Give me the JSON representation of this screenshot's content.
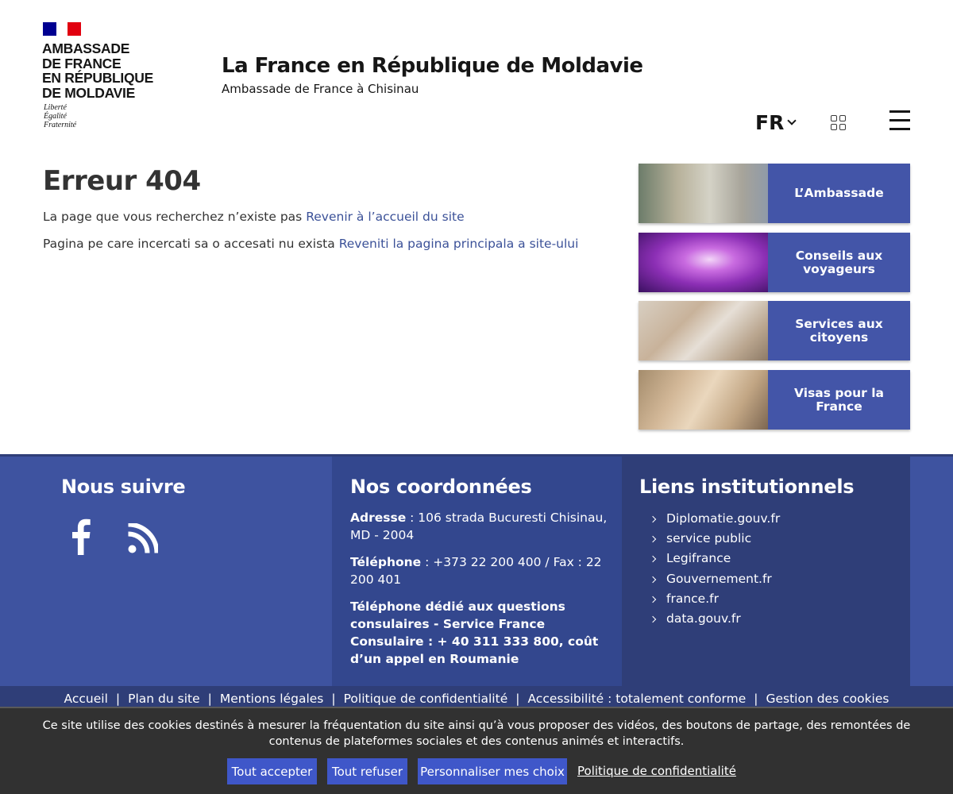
{
  "header": {
    "embassy_lines": [
      "AMBASSADE",
      "DE FRANCE",
      "EN RÉPUBLIQUE",
      "DE MOLDAVIE"
    ],
    "motto_lines": [
      "Liberté",
      "Égalité",
      "Fraternité"
    ],
    "site_title": "La France en République de Moldavie",
    "site_subtitle": "Ambassade de France à Chisinau",
    "language": "FR"
  },
  "main": {
    "title": "Erreur 404",
    "line1_text": "La page que vous recherchez n’existe pas ",
    "line1_link": "Revenir à l’accueil du site",
    "line2_text": "Pagina pe care incercati sa o accesati nu exista ",
    "line2_link": "Reveniti la pagina principala a site-ului"
  },
  "cards": [
    {
      "label": "L’Ambassade"
    },
    {
      "label": "Conseils aux voyageurs"
    },
    {
      "label": "Services aux citoyens"
    },
    {
      "label": "Visas pour la France"
    }
  ],
  "footer": {
    "follow_title": "Nous suivre",
    "contact_title": "Nos coordonnées",
    "address_label": "Adresse",
    "address_value": " : 106 strada Bucuresti Chisinau, MD - 2004",
    "phone_label": "Téléphone",
    "phone_value": " : +373 22 200 400 / Fax : 22 200 401",
    "consular_text": "Téléphone dédié aux questions consulaires - Service France Consulaire : + 40 311 333 800, coût d’un appel en Roumanie",
    "links_title": "Liens institutionnels",
    "links": [
      "Diplomatie.gouv.fr",
      "service public",
      "Legifrance",
      "Gouvernement.fr",
      "france.fr",
      "data.gouv.fr"
    ],
    "bottom_links": [
      "Accueil",
      "Plan du site",
      "Mentions légales",
      "Politique de confidentialité",
      "Accessibilité : totalement conforme",
      "Gestion des cookies"
    ]
  },
  "cookie": {
    "message": "Ce site utilise des cookies destinés à mesurer la fréquentation du site ainsi qu’à vous proposer des vidéos, des boutons de partage, des remontées de contenus de plateformes sociales et des contenus animés et interactifs.",
    "accept": "Tout accepter",
    "refuse": "Tout refuser",
    "customize": "Personnaliser mes choix",
    "policy": "Politique de confidentialité"
  },
  "colors": {
    "card_blue": "#4355a8",
    "footer_blue": "#3e53a0",
    "link_blue": "#3b5198",
    "button_blue": "#3f57c9"
  }
}
